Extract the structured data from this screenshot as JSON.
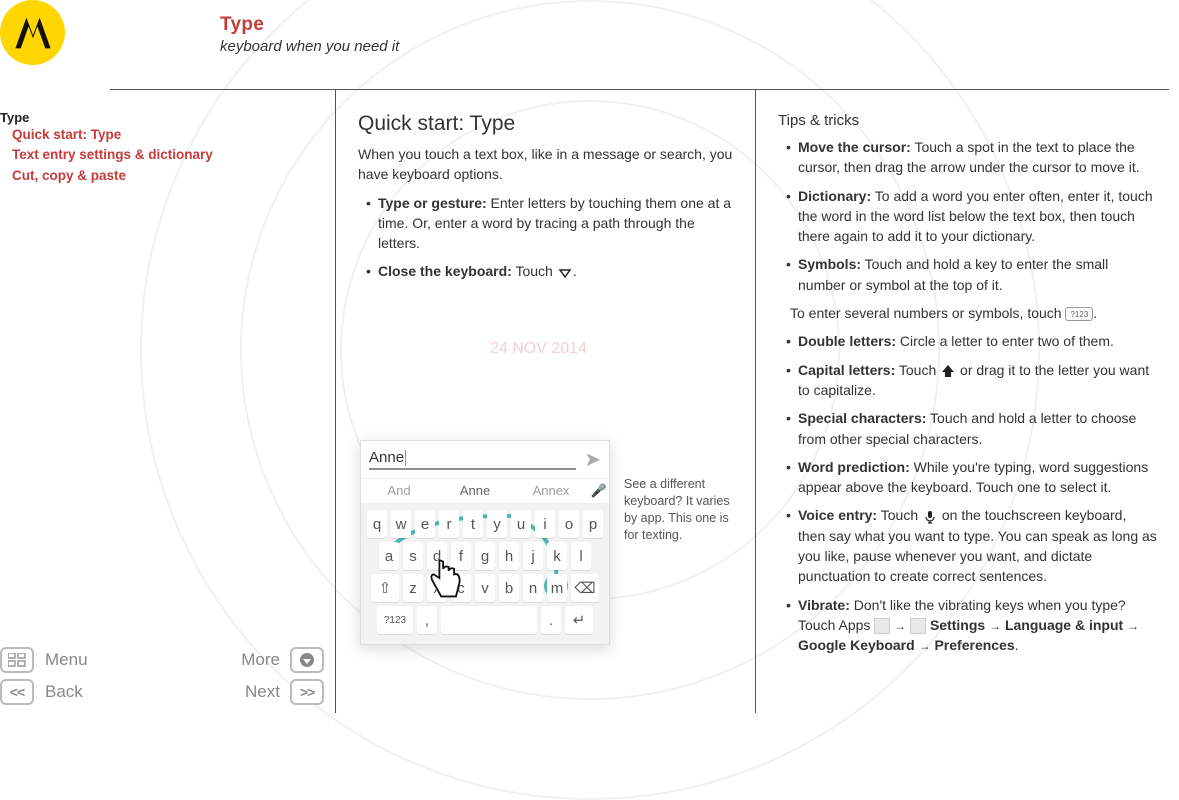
{
  "header": {
    "title": "Type",
    "subtitle": "keyboard when you need it"
  },
  "watermark_date": "24 NOV 2014",
  "toc": {
    "heading": "Type",
    "items": [
      "Quick start: Type",
      "Text entry settings & dictionary",
      "Cut, copy & paste"
    ]
  },
  "nav": {
    "menu": "Menu",
    "more": "More",
    "back": "Back",
    "next": "Next",
    "back_sym": "<<",
    "next_sym": ">>"
  },
  "col1": {
    "heading": "Quick start: Type",
    "intro": "When you touch a text box, like in a message or search, you have keyboard options.",
    "b1_label": "Type or gesture:",
    "b1_text": " Enter letters by touching them one at a time. Or, enter a word by tracing a path through the letters.",
    "b2_label": "Close the keyboard:",
    "b2_text_before": " Touch ",
    "b2_text_after": ".",
    "phone": {
      "input_value": "Anne",
      "pred1": "And",
      "pred2": "Anne",
      "pred3": "Annex",
      "row1": [
        "q",
        "w",
        "e",
        "r",
        "t",
        "y",
        "u",
        "i",
        "o",
        "p"
      ],
      "row2": [
        "a",
        "s",
        "d",
        "f",
        "g",
        "h",
        "j",
        "k",
        "l"
      ],
      "row3": [
        "z",
        "x",
        "c",
        "v",
        "b",
        "n",
        "m"
      ],
      "sym_key": "?123"
    },
    "caption": "See a different keyboard? It varies by app. This one is for texting."
  },
  "col2": {
    "heading": "Tips & tricks",
    "items": [
      {
        "label": "Move the cursor:",
        "text": " Touch a spot in the text to place the cursor, then drag the arrow under the cursor to move it."
      },
      {
        "label": "Dictionary:",
        "text": " To add a word you enter often, enter it, touch the word in the word list below the text box, then touch there again to add it to your dictionary."
      },
      {
        "label": "Symbols:",
        "text": " Touch and hold a key to enter the small number or symbol at the top of it."
      },
      {
        "label": "Double letters:",
        "text": " Circle a letter to enter two of them."
      },
      {
        "label": "Capital letters:",
        "text_before": " Touch ",
        "text_after": " or drag it to the letter you want to capitalize."
      },
      {
        "label": "Special characters:",
        "text": " Touch and hold a letter to choose from other special characters."
      },
      {
        "label": "Word prediction:",
        "text": " While you're typing, word suggestions appear above the keyboard. Touch one to select it."
      },
      {
        "label": "Voice entry:",
        "text_before": " Touch ",
        "text_after": " on the touchscreen keyboard, then say what you want to type. You can speak as long as you like, pause whenever you want, and dictate punctuation to create correct sentences."
      },
      {
        "label": "Vibrate:",
        "text_before": " Don't like the vibrating keys when you type? Touch Apps ",
        "path": [
          "Settings",
          "Language & input",
          "Google Keyboard",
          "Preferences"
        ]
      }
    ],
    "symbols_follow_before": "To enter several numbers or symbols, touch ",
    "symbols_follow_key": "?123",
    "symbols_follow_after": "."
  }
}
